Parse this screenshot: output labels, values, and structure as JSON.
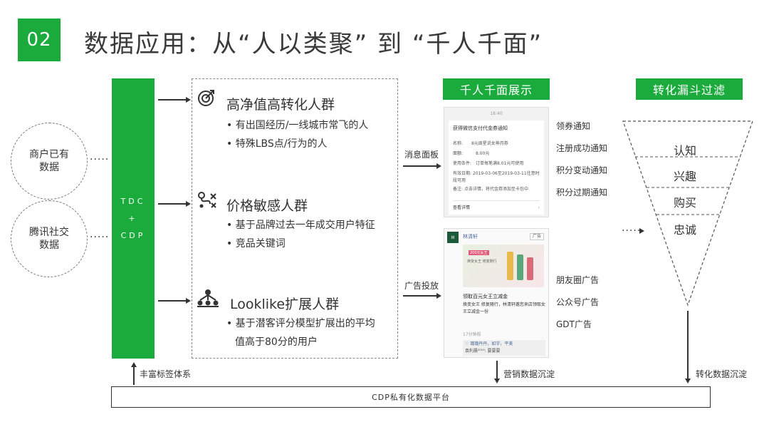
{
  "header": {
    "badge": "02",
    "title": "数据应用：从“人以类聚” 到 “千人千面”"
  },
  "sources": [
    {
      "label": "商户已有数据"
    },
    {
      "label": "腾讯社交数据"
    }
  ],
  "dots": "·····",
  "tdc": {
    "line1": "TDC",
    "line2": "+",
    "line3": "CDP"
  },
  "groups": [
    {
      "title": "高净值高转化人群",
      "bullets": [
        "• 有出国经历/一线城市常飞的人",
        "• 特殊LBS点/行为的人"
      ]
    },
    {
      "title": "价格敏感人群",
      "bullets": [
        "• 基于品牌过去一年成交用户特征",
        "• 竞品关键词"
      ]
    },
    {
      "title": "Looklike扩展人群",
      "bullets": [
        "• 基于潜客评分模型扩展出的平均",
        "值高于80分的用户"
      ]
    }
  ],
  "channels": {
    "message": "消息面板",
    "ad": "广告投放"
  },
  "display": {
    "label": "千人千面展示",
    "notice_card": {
      "time": "18:40",
      "heading": "获得微信支付代金券通知",
      "rows": [
        {
          "k": "名称:",
          "v": "8元周星说女神月券"
        },
        {
          "k": "面额:",
          "v": "8.00元"
        },
        {
          "k": "使用条件:",
          "v": "订单每笔满8.01元可使用"
        },
        {
          "k": "有效日期:",
          "v": "2019-03-06至2019-03-11往意时段可用"
        },
        {
          "k": "备注:",
          "v": "点击详情，将代金券添加至卡包中"
        }
      ],
      "footer": "查看详情"
    },
    "ad_card": {
      "brand": "林清轩",
      "tag": "广告",
      "image_text_1": "焕变女王 修复随行",
      "image_text_2": "200元女王",
      "headline": "领取百元女王立减金",
      "body": "焕变女王 修复随行，林清轩邀您来店领取女王立减金一份",
      "time": "17分钟前",
      "likes": "♡ 璐璐丹丹，如宇，平美",
      "comment": "袁利晨²⁰¹⁹: 要要要"
    },
    "notices": [
      "领券通知",
      "注册成功通知",
      "积分变动通知",
      "积分过期通知"
    ],
    "ads": [
      "朋友圈广告",
      "公众号广告",
      "GDT广告"
    ]
  },
  "funnel": {
    "label": "转化漏斗过滤",
    "stages": [
      "认知",
      "兴趣",
      "购买",
      "忠诚"
    ]
  },
  "bottom": {
    "tags": "丰富标签体系",
    "marketing": "营销数据沉淀",
    "conversion": "转化数据沉淀",
    "platform": "CDP私有化数据平台"
  },
  "colors": {
    "accent": "#1aab3c"
  }
}
